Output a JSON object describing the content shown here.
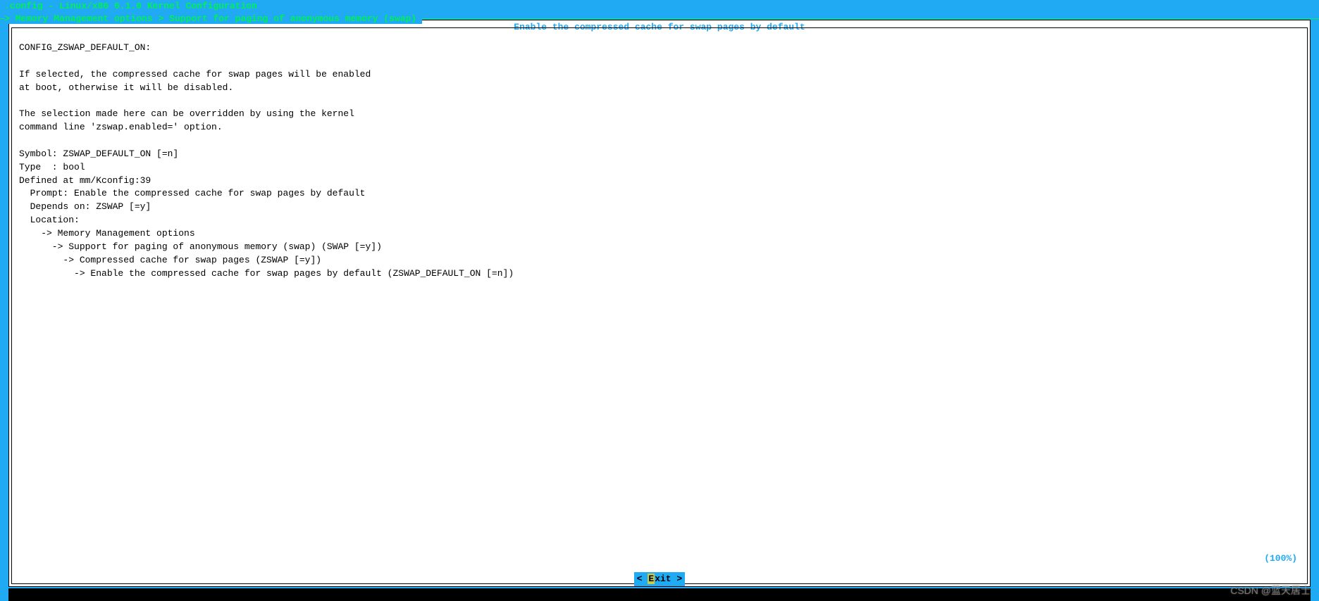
{
  "header": {
    "title": ".config - Linux/x86 6.1.0 Kernel Configuration"
  },
  "breadcrumb": {
    "path": "> Memory Management options > Support for paging of anonymous memory (swap)"
  },
  "help": {
    "title": "Enable the compressed cache for swap pages by default",
    "body": "CONFIG_ZSWAP_DEFAULT_ON:\n\nIf selected, the compressed cache for swap pages will be enabled\nat boot, otherwise it will be disabled.\n\nThe selection made here can be overridden by using the kernel\ncommand line 'zswap.enabled=' option.\n\nSymbol: ZSWAP_DEFAULT_ON [=n]\nType  : bool\nDefined at mm/Kconfig:39\n  Prompt: Enable the compressed cache for swap pages by default\n  Depends on: ZSWAP [=y]\n  Location:\n    -> Memory Management options\n      -> Support for paging of anonymous memory (swap) (SWAP [=y])\n        -> Compressed cache for swap pages (ZSWAP [=y])\n          -> Enable the compressed cache for swap pages by default (ZSWAP_DEFAULT_ON [=n])"
  },
  "footer": {
    "percent": "(100%)",
    "exit_prefix": "< ",
    "exit_hotkey": "E",
    "exit_suffix": "xit >"
  },
  "watermark": "CSDN @蓝天居士"
}
